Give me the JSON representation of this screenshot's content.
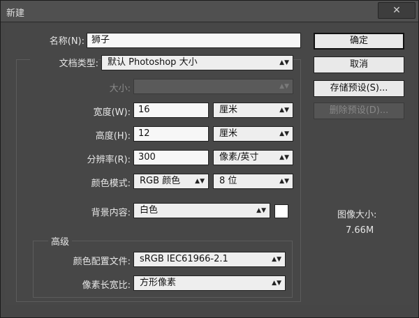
{
  "window": {
    "title": "新建",
    "close_glyph": "✕"
  },
  "form": {
    "name_label": "名称(N):",
    "name_value": "狮子",
    "doc_type_label": "文档类型:",
    "doc_type_value": "默认 Photoshop 大小",
    "size_label": "大小:",
    "size_value": "",
    "width_label": "宽度(W):",
    "width_value": "16",
    "width_unit": "厘米",
    "height_label": "高度(H):",
    "height_value": "12",
    "height_unit": "厘米",
    "resolution_label": "分辨率(R):",
    "resolution_value": "300",
    "resolution_unit": "像素/英寸",
    "color_mode_label": "颜色模式:",
    "color_mode_value": "RGB 颜色",
    "bit_depth_value": "8 位",
    "background_label": "背景内容:",
    "background_value": "白色",
    "background_swatch_color": "#ffffff"
  },
  "advanced": {
    "header": "高级",
    "profile_label": "颜色配置文件:",
    "profile_value": "sRGB IEC61966-2.1",
    "pixel_aspect_label": "像素长宽比:",
    "pixel_aspect_value": "方形像素"
  },
  "buttons": {
    "ok": "确定",
    "cancel": "取消",
    "save_preset": "存储预设(S)...",
    "delete_preset": "删除预设(D)..."
  },
  "image_size": {
    "label": "图像大小:",
    "value": "7.66M"
  },
  "icons": {
    "dropdown_arrow": "▲▼"
  }
}
